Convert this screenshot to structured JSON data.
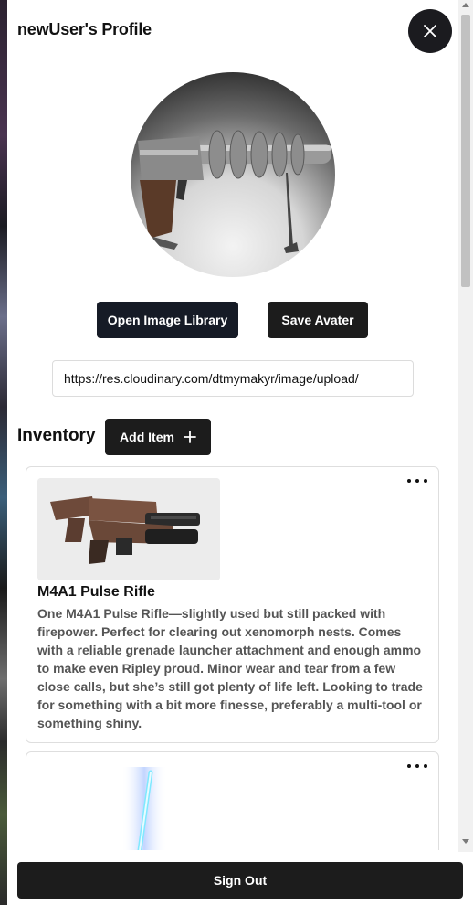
{
  "profile": {
    "title": "newUser's Profile",
    "avatar_alt": "ray gun avatar"
  },
  "buttons": {
    "open_library": "Open Image Library",
    "save_avatar": "Save Avater",
    "add_item": "Add Item",
    "sign_out": "Sign Out"
  },
  "avatar_url": {
    "value": "https://res.cloudinary.com/dtmymakyr/image/upload/"
  },
  "inventory": {
    "title": "Inventory",
    "items": [
      {
        "name": "M4A1 Pulse Rifle",
        "description": "One M4A1 Pulse Rifle—slightly used but still packed with firepower. Perfect for clearing out xenomorph nests. Comes with a reliable grenade launcher attachment and enough ammo to make even Ripley proud. Minor wear and tear from a few close calls, but she’s still got plenty of life left. Looking to trade for something with a bit more finesse, preferably a multi-tool or something shiny."
      },
      {
        "name": "",
        "description": ""
      }
    ]
  },
  "icons": {
    "close": "close-icon",
    "add": "plus-icon",
    "more": "more-horizontal-icon"
  },
  "colors": {
    "dark_button": "#1c1c1c",
    "library_button": "#161b26",
    "card_border": "#dedede",
    "text_muted": "#555555"
  }
}
